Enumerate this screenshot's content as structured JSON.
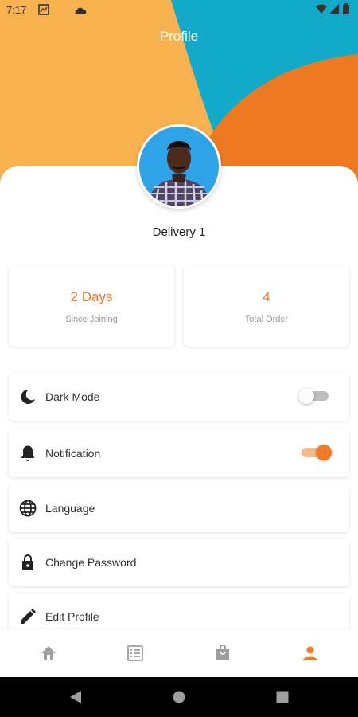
{
  "status_bar": {
    "time": "7:17"
  },
  "header": {
    "title": "Profile"
  },
  "profile": {
    "name": "Delivery 1"
  },
  "stats": [
    {
      "value": "2 Days",
      "label": "Since Joining"
    },
    {
      "value": "4",
      "label": "Total Order"
    }
  ],
  "settings": {
    "dark_mode": {
      "label": "Dark Mode",
      "icon": "moon-icon",
      "enabled": false
    },
    "notification": {
      "label": "Notification",
      "icon": "bell-icon",
      "enabled": true
    },
    "language": {
      "label": "Language",
      "icon": "globe-icon"
    },
    "change_password": {
      "label": "Change Password",
      "icon": "lock-icon"
    },
    "edit_profile": {
      "label": "Edit Profile",
      "icon": "pencil-icon"
    }
  },
  "bottom_nav": {
    "items": [
      "home-icon",
      "orders-list-icon",
      "shopping-bag-icon",
      "profile-icon"
    ],
    "active": "profile-icon"
  },
  "colors": {
    "accent": "#ee7c24",
    "header_orange": "#f8b14f",
    "header_teal": "#13a9c8",
    "toggle_track_on": "#f5b98a",
    "inactive_icon": "#9e9e9e"
  }
}
